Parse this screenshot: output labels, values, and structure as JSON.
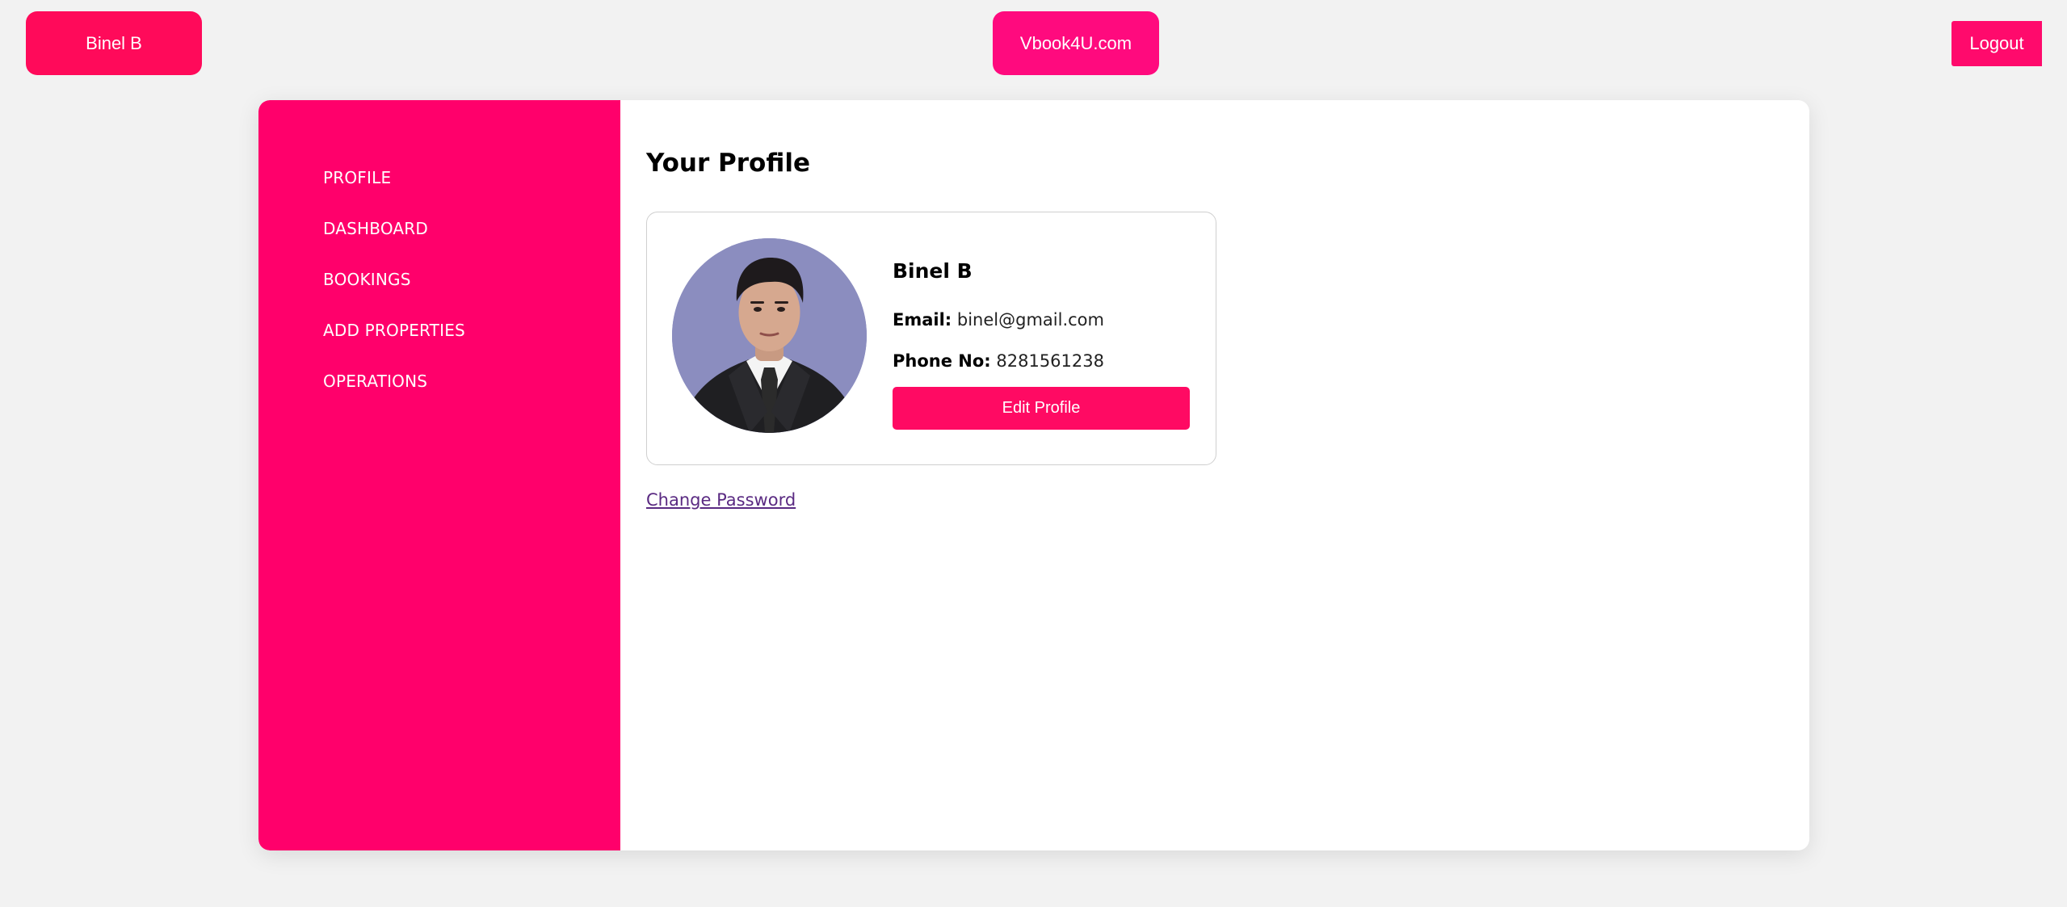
{
  "header": {
    "user_label": "Binel B",
    "brand_label": "Vbook4U.com",
    "logout_label": "Logout"
  },
  "sidebar": {
    "items": [
      {
        "label": "PROFILE"
      },
      {
        "label": "DASHBOARD"
      },
      {
        "label": "BOOKINGS"
      },
      {
        "label": "ADD PROPERTIES"
      },
      {
        "label": "OPERATIONS"
      }
    ]
  },
  "main": {
    "title": "Your Profile",
    "profile": {
      "name": "Binel B",
      "email_label": "Email:",
      "email": "binel@gmail.com",
      "phone_label": "Phone No:",
      "phone": "8281561238",
      "edit_label": "Edit Profile"
    },
    "change_password_label": "Change Password"
  },
  "colors": {
    "accent": "#ff006b",
    "background": "#f2f2f2",
    "link": "#5a2a82"
  },
  "icons": {
    "avatar": "profile-photo"
  }
}
